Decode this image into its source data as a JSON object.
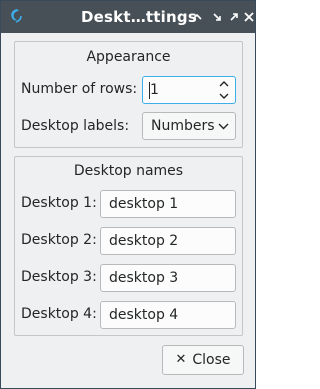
{
  "window": {
    "title": "Deskt…ttings"
  },
  "titlebar_buttons": {
    "keep_above_icon": "keep-above-icon",
    "minimize_icon": "minimize-icon",
    "maximize_icon": "maximize-icon",
    "close_icon": "close-icon"
  },
  "appearance": {
    "title": "Appearance",
    "rows_label": "Number of rows:",
    "rows_value": "1",
    "labels_label": "Desktop labels:",
    "labels_value": "Numbers"
  },
  "desktop_names": {
    "title": "Desktop names",
    "items": [
      {
        "label": "Desktop 1:",
        "value": "desktop 1"
      },
      {
        "label": "Desktop 2:",
        "value": "desktop 2"
      },
      {
        "label": "Desktop 3:",
        "value": "desktop 3"
      },
      {
        "label": "Desktop 4:",
        "value": "desktop 4"
      }
    ]
  },
  "footer": {
    "close_label": "Close"
  },
  "colors": {
    "titlebar": "#475057",
    "window_bg": "#eff0f1",
    "focus_accent": "#3daee9"
  }
}
